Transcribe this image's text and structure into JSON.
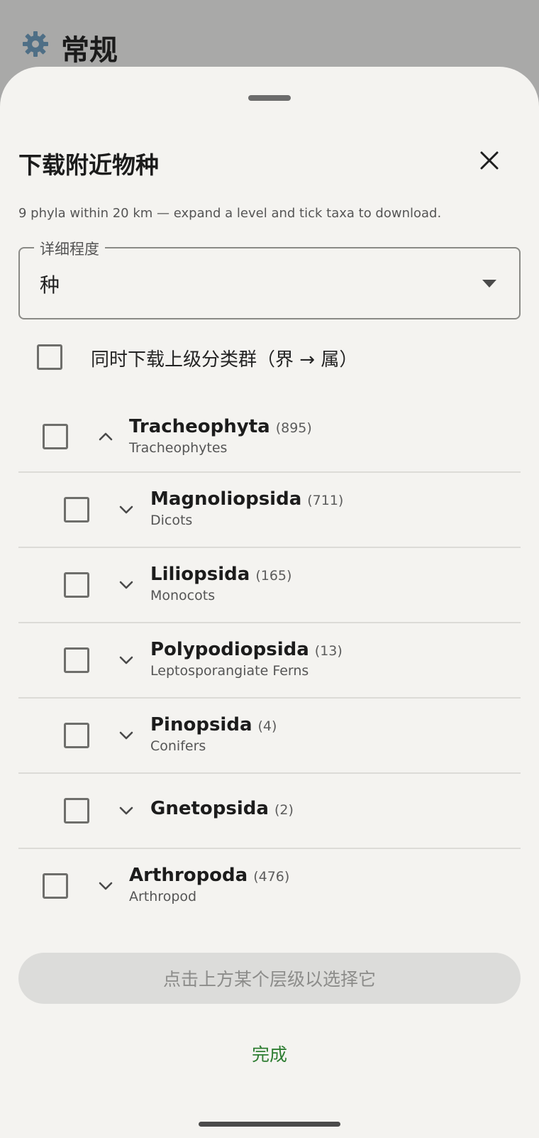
{
  "background": {
    "title": "常规",
    "icon": "gear-icon"
  },
  "sheet": {
    "title": "下载附近物种",
    "subtitle": "9 phyla within 20 km — expand a level and tick taxa to download.",
    "detail_level": {
      "label": "详细程度",
      "value": "种"
    },
    "include_ancestors": {
      "label": "同时下载上级分类群（界 → 属）",
      "checked": false
    },
    "taxa": [
      {
        "name": "Tracheophyta",
        "count": "(895)",
        "common": "Tracheophytes",
        "expanded": true,
        "level": 0,
        "checked": false
      },
      {
        "name": "Magnoliopsida",
        "count": "(711)",
        "common": "Dicots",
        "expanded": false,
        "level": 1,
        "checked": false
      },
      {
        "name": "Liliopsida",
        "count": "(165)",
        "common": "Monocots",
        "expanded": false,
        "level": 1,
        "checked": false
      },
      {
        "name": "Polypodiopsida",
        "count": "(13)",
        "common": "Leptosporangiate Ferns",
        "expanded": false,
        "level": 1,
        "checked": false
      },
      {
        "name": "Pinopsida",
        "count": "(4)",
        "common": "Conifers",
        "expanded": false,
        "level": 1,
        "checked": false
      },
      {
        "name": "Gnetopsida",
        "count": "(2)",
        "common": "",
        "expanded": false,
        "level": 1,
        "checked": false
      },
      {
        "name": "Arthropoda",
        "count": "(476)",
        "common": "Arthropod",
        "expanded": false,
        "level": 0,
        "checked": false
      }
    ],
    "action_button": "点击上方某个层级以选择它",
    "done_button": "完成"
  },
  "colors": {
    "accent": "#2e7d32",
    "sheet_background": "#f4f3f0",
    "scrim": "#a8a8a8"
  }
}
